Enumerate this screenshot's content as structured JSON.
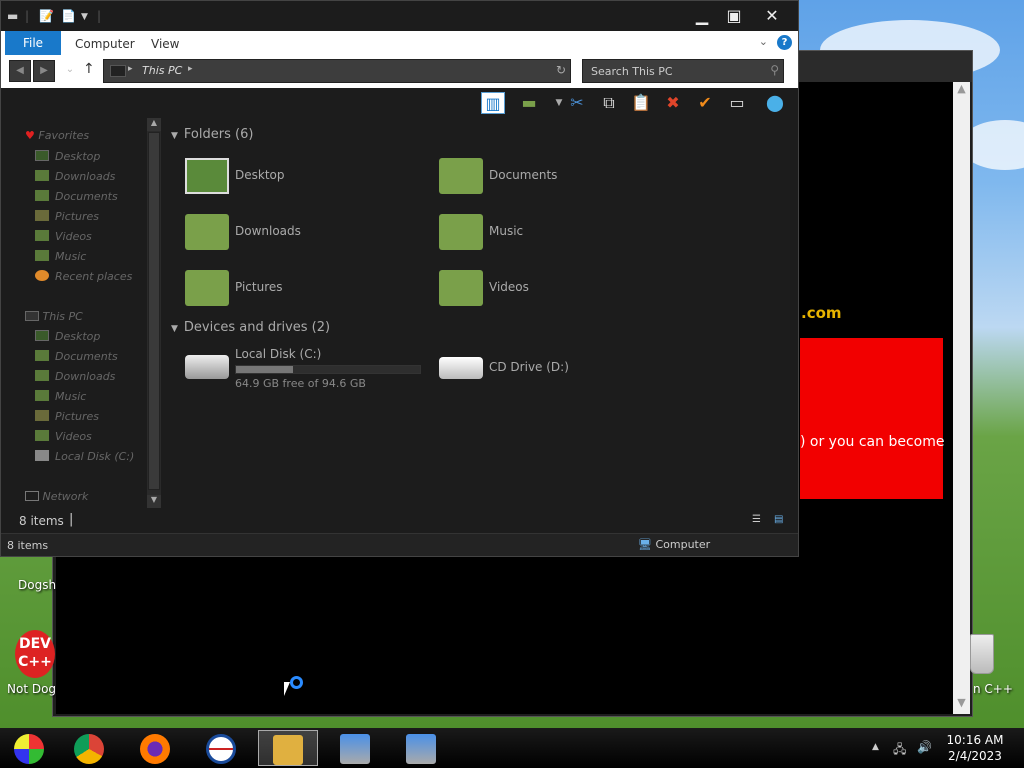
{
  "explorer": {
    "ribbon": {
      "file_tab": "File",
      "tabs": [
        "Computer",
        "View"
      ],
      "help": "?"
    },
    "address": {
      "location": "This PC",
      "search_placeholder": "Search This PC"
    },
    "nav": {
      "favorites": "Favorites",
      "favorites_items": [
        "Desktop",
        "Downloads",
        "Documents",
        "Pictures",
        "Videos",
        "Music",
        "Recent places"
      ],
      "thispc": "This PC",
      "thispc_items": [
        "Desktop",
        "Documents",
        "Downloads",
        "Music",
        "Pictures",
        "Videos",
        "Local Disk (C:)"
      ],
      "network": "Network"
    },
    "folders_header": "Folders (6)",
    "folders": [
      "Desktop",
      "Documents",
      "Downloads",
      "Music",
      "Pictures",
      "Videos"
    ],
    "drives_header": "Devices and drives (2)",
    "drives": [
      {
        "name": "Local Disk (C:)",
        "free": "64.9 GB free of 94.6 GB",
        "used_fraction": 0.31
      },
      {
        "name": "CD Drive (D:)"
      }
    ],
    "status_count": "8 items",
    "status_count_outer": "8 items",
    "status_zone": "Computer"
  },
  "background_page": {
    "domain_fragment": ".com",
    "banner_text": ") or you can become"
  },
  "desktop_icons": {
    "dogs": "Dogsh",
    "not_dog": "Not Dog",
    "dev_logo": "DEV C++",
    "cpp": "n C++"
  },
  "taskbar": {
    "time": "10:16 AM",
    "date": "2/4/2023"
  },
  "colors": {
    "accent": "#1979ca",
    "banner_red": "#f20000",
    "folder_green": "#7aa04a"
  }
}
